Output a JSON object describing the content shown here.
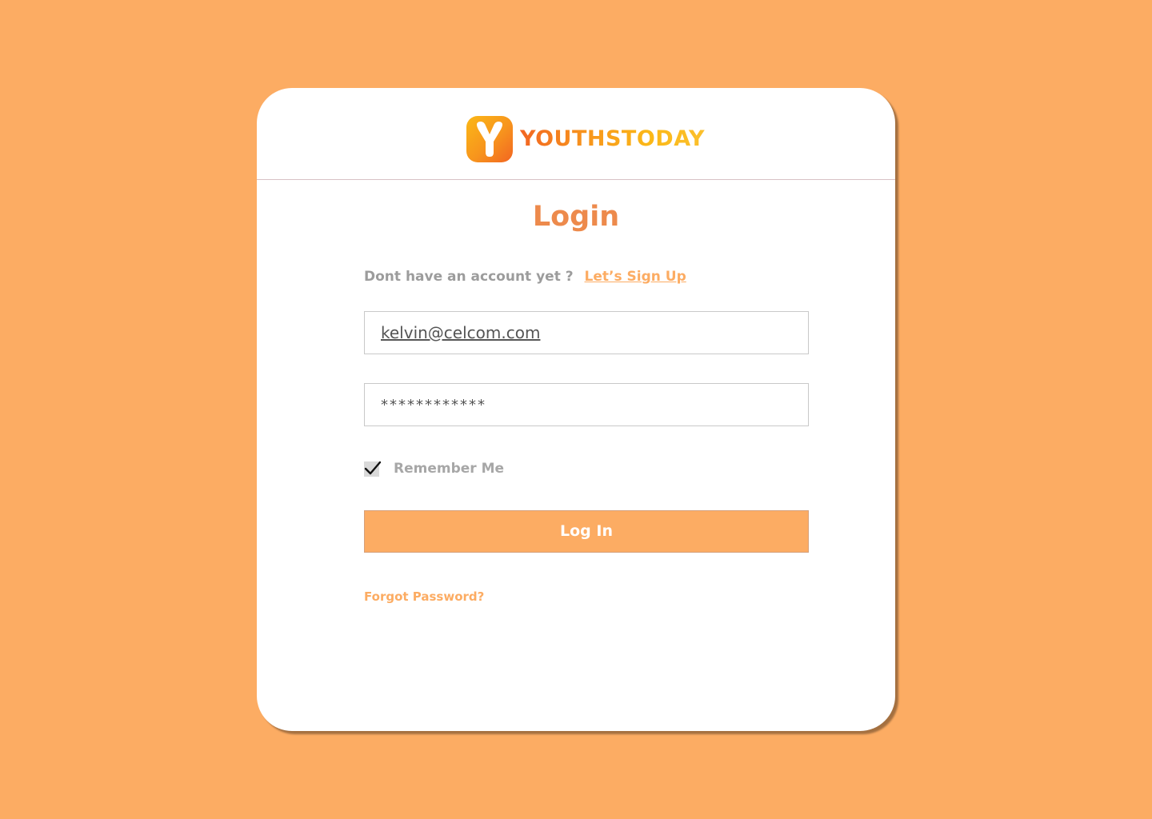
{
  "brand": {
    "logo_letter": "Y",
    "name": "YOUTHSTODAY",
    "colors": {
      "primary": "#fcac63",
      "title": "#ed8a4c",
      "logo_orange": "#f7941d",
      "logo_yellow": "#fbb817"
    }
  },
  "login": {
    "title": "Login",
    "signup_prompt": "Dont have an account yet ?",
    "signup_link": "Let’s Sign Up",
    "email_value": "kelvin@celcom.com",
    "password_value": "************",
    "remember_label": "Remember Me",
    "remember_checked": true,
    "submit_label": "Log In",
    "forgot_label": "Forgot Password?"
  },
  "icons": {
    "logo": "youthstoday-y-icon",
    "checkbox": "checkmark-icon"
  }
}
